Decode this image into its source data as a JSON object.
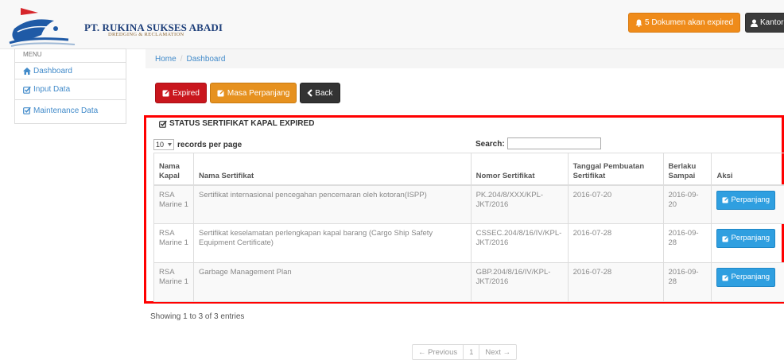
{
  "header": {
    "brand_name": "PT. RUKINA SUKSES ABADI",
    "brand_sub": "DREDGING & RECLAMATION",
    "expiring_button": "5 Dokumen akan expired",
    "user_button": "Kantor",
    "colors": {
      "warning": "#ef8b1a",
      "dark": "#3b3b3b",
      "brand": "#1e3f7a"
    }
  },
  "sidebar": {
    "heading": "MENU",
    "items": [
      {
        "label": "Dashboard",
        "icon": "home-icon"
      },
      {
        "label": "Input Data",
        "icon": "edit-check-icon"
      },
      {
        "label": "Maintenance Data",
        "icon": "edit-check-icon"
      }
    ]
  },
  "breadcrumb": {
    "home": "Home",
    "separator": "/",
    "current": "Dashboard"
  },
  "actions": {
    "expired": "Expired",
    "masa_perpanjang": "Masa Perpanjang",
    "back": "Back"
  },
  "panel": {
    "title": "STATUS SERTIFIKAT KAPAL EXPIRED",
    "records_per_page_value": "10",
    "records_per_page_label": "records per page",
    "search_label": "Search:",
    "search_value": "",
    "columns": [
      "Nama Kapal",
      "Nama Sertifikat",
      "Nomor Sertifikat",
      "Tanggal Pembuatan Sertifikat",
      "Berlaku Sampai",
      "Aksi"
    ],
    "rows": [
      {
        "kapal": "RSA Marine 1",
        "sertifikat": "Sertifikat internasional pencegahan pencemaran oleh kotoran(ISPP)",
        "nomor": "PK.204/8/XXX/KPL-JKT/2016",
        "tanggal": "2016-07-20",
        "berlaku": "2016-09-20",
        "aksi": "Perpanjang"
      },
      {
        "kapal": "RSA Marine 1",
        "sertifikat": "Sertifikat keselamatan perlengkapan kapal barang (Cargo Ship Safety Equipment Certificate)",
        "nomor": "CSSEC.204/8/16/IV/KPL-JKT/2016",
        "tanggal": "2016-07-28",
        "berlaku": "2016-09-28",
        "aksi": "Perpanjang"
      },
      {
        "kapal": "RSA Marine 1",
        "sertifikat": "Garbage Management Plan",
        "nomor": "GBP.204/8/16/IV/KPL-JKT/2016",
        "tanggal": "2016-07-28",
        "berlaku": "2016-09-28",
        "aksi": "Perpanjang"
      }
    ],
    "showing": "Showing 1 to 3 of 3 entries"
  },
  "pagination": {
    "previous": "← Previous",
    "page": "1",
    "next": "Next →"
  }
}
